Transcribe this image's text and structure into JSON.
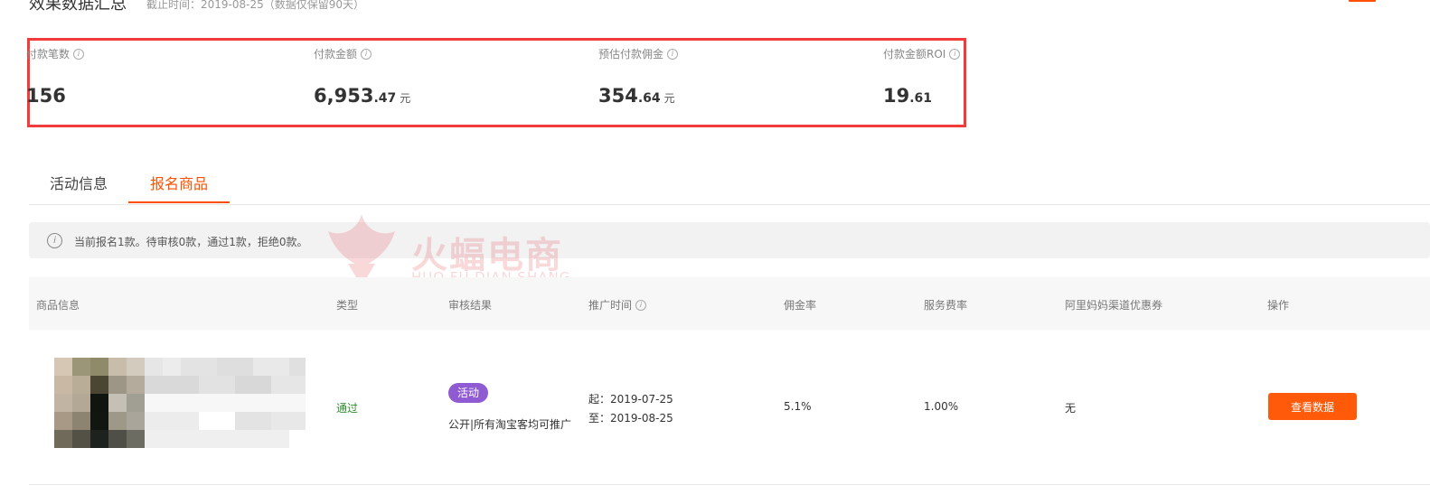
{
  "header": {
    "title": "效果数据汇总",
    "subtitle": "截止时间：2019-08-25（数据仅保留90天）"
  },
  "stats": [
    {
      "label": "付款笔数",
      "int": "156",
      "dec": "",
      "unit": ""
    },
    {
      "label": "付款金额",
      "int": "6,953",
      "dec": ".47",
      "unit": "元"
    },
    {
      "label": "预估付款佣金",
      "int": "354",
      "dec": ".64",
      "unit": "元"
    },
    {
      "label": "付款金额ROI",
      "int": "19",
      "dec": ".61",
      "unit": ""
    }
  ],
  "tabs": [
    {
      "label": "活动信息",
      "active": false
    },
    {
      "label": "报名商品",
      "active": true
    }
  ],
  "notice": {
    "text": "当前报名1款。待审核0款，通过1款，拒绝0款。"
  },
  "watermark": {
    "cn": "火蝠电商",
    "en": "HUO FU DIAN SHANG"
  },
  "table": {
    "headers": [
      "商品信息",
      "类型",
      "审核结果",
      "推广时间",
      "佣金率",
      "服务费率",
      "阿里妈妈渠道优惠券",
      "操作"
    ],
    "row": {
      "type": "通过",
      "review_tag": "活动",
      "review_text": "公开|所有淘宝客均可推广",
      "start": "起：2019-07-25",
      "end": "至：2019-08-25",
      "commission": "5.1%",
      "service_rate": "1.00%",
      "coupon": "无",
      "action": "查看数据"
    }
  },
  "colors": {
    "accent": "#ff5000",
    "highlight_border": "#f23b3b",
    "tag_purple": "#8e5bd3",
    "pass_green": "#2e8b2e"
  },
  "icons": {
    "info": "info-circle-icon"
  }
}
